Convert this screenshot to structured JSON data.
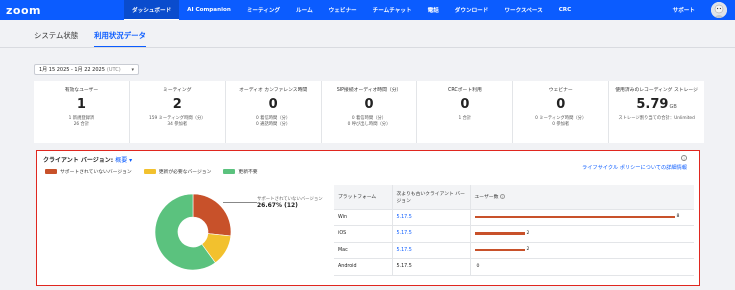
{
  "topnav": {
    "logo": "zoom",
    "items": [
      "ダッシュボード",
      "AI Companion",
      "ミーティング",
      "ルーム",
      "ウェビナー",
      "チームチャット",
      "電話",
      "ダウンロード",
      "ワークスペース",
      "CRC"
    ],
    "active_index": 0,
    "support": "サポート"
  },
  "tabs": [
    "システム状態",
    "利用状況データ"
  ],
  "active_tab": 1,
  "daterange": {
    "range": "1月 15 2025 - 1月 22 2025",
    "tz": "(UTC)"
  },
  "stats": [
    {
      "title": "有効なユーザー",
      "value": "1",
      "unit": "",
      "sub1": "1 新規登録済",
      "sub2": "26 合計"
    },
    {
      "title": "ミーティング",
      "value": "2",
      "unit": "",
      "sub1": "159 ミーティング時間（分）",
      "sub2": "34 参加者"
    },
    {
      "title": "オーディオ カンファレンス時間",
      "value": "0",
      "unit": "",
      "sub1": "0 着信時間（分）",
      "sub2": "0 通話時間（分）"
    },
    {
      "title": "SIP接続オーディオ時間（分）",
      "value": "0",
      "unit": "",
      "sub1": "0 着信時間（分）",
      "sub2": "0 呼び出し時間（分）"
    },
    {
      "title": "CRCポート利用",
      "value": "0",
      "unit": "",
      "sub1": "1 合計",
      "sub2": ""
    },
    {
      "title": "ウェビナー",
      "value": "0",
      "unit": "",
      "sub1": "0 ミーティング時間（分）",
      "sub2": "0 参加者"
    },
    {
      "title": "使用済みのレコーディング ストレージ",
      "value": "5.79",
      "unit": "GB",
      "sub1": "ストレージ割り当ての合計：Unlimited",
      "sub2": ""
    }
  ],
  "panel": {
    "title": "クライアント バージョン:",
    "summary": "概要",
    "link": "ライフサイクル ポリシーについての詳細情報",
    "legend": [
      {
        "label": "サポートされていないバージョン",
        "color": "#c8512a"
      },
      {
        "label": "更新が必要なバージョン",
        "color": "#f2c12e"
      },
      {
        "label": "更新不要",
        "color": "#5bc27e"
      }
    ]
  },
  "chart_data": {
    "type": "pie",
    "title": "",
    "slices": [
      {
        "label": "サポートされていないバージョン",
        "value": 12,
        "percent": 26.67,
        "color": "#c8512a"
      },
      {
        "label": "更新が必要なバージョン",
        "value": 6,
        "percent": 13.33,
        "color": "#f2c12e"
      },
      {
        "label": "更新不要",
        "value": 27,
        "percent": 60.0,
        "color": "#5bc27e"
      }
    ],
    "callout": {
      "label": "サポートされていないバージョン",
      "value_text": "26.67% (12)"
    }
  },
  "table": {
    "headers": {
      "platform": "プラットフォーム",
      "version": "次よりも古いクライアント バージョン",
      "users": "ユーザー数"
    },
    "rows": [
      {
        "platform": "Win",
        "version": "5.17.5",
        "count": 8,
        "linked": true
      },
      {
        "platform": "iOS",
        "version": "5.17.5",
        "count": 2,
        "linked": true
      },
      {
        "platform": "Mac",
        "version": "5.17.5",
        "count": 2,
        "linked": true
      },
      {
        "platform": "Android",
        "version": "5.17.5",
        "count": 0,
        "linked": false
      }
    ],
    "bar_max": 8,
    "bar_color": "#c8512a"
  }
}
